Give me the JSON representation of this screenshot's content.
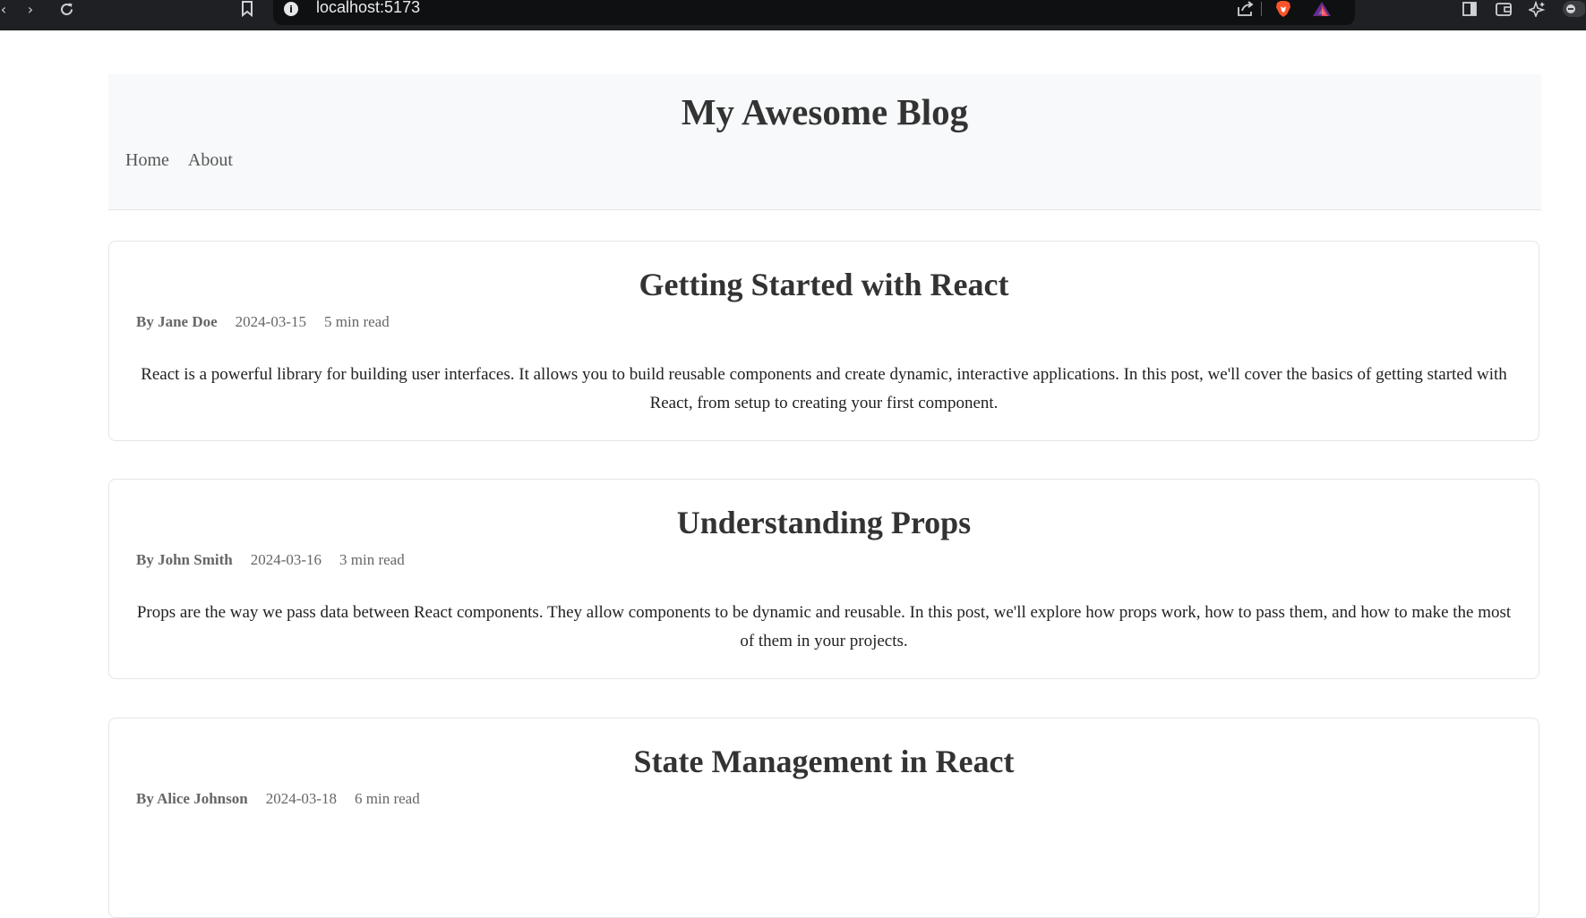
{
  "browser": {
    "url": "localhost:5173",
    "info_glyph": "i"
  },
  "site": {
    "title": "My Awesome Blog",
    "nav": [
      {
        "label": "Home"
      },
      {
        "label": "About"
      }
    ]
  },
  "posts": [
    {
      "title": "Getting Started with React",
      "author": "By Jane Doe",
      "date": "2024-03-15",
      "read_time": "5 min read",
      "excerpt": "React is a powerful library for building user interfaces. It allows you to build reusable components and create dynamic, interactive applications. In this post, we'll cover the basics of getting started with React, from setup to creating your first component."
    },
    {
      "title": "Understanding Props",
      "author": "By John Smith",
      "date": "2024-03-16",
      "read_time": "3 min read",
      "excerpt": "Props are the way we pass data between React components. They allow components to be dynamic and reusable. In this post, we'll explore how props work, how to pass them, and how to make the most of them in your projects."
    },
    {
      "title": "State Management in React",
      "author": "By Alice Johnson",
      "date": "2024-03-18",
      "read_time": "6 min read",
      "excerpt": ""
    }
  ],
  "colors": {
    "chrome_bg": "#1f2023",
    "header_bg": "#f8f9fa",
    "card_border": "#e3e5e8",
    "title_text": "#333333",
    "meta_text": "#666666"
  }
}
